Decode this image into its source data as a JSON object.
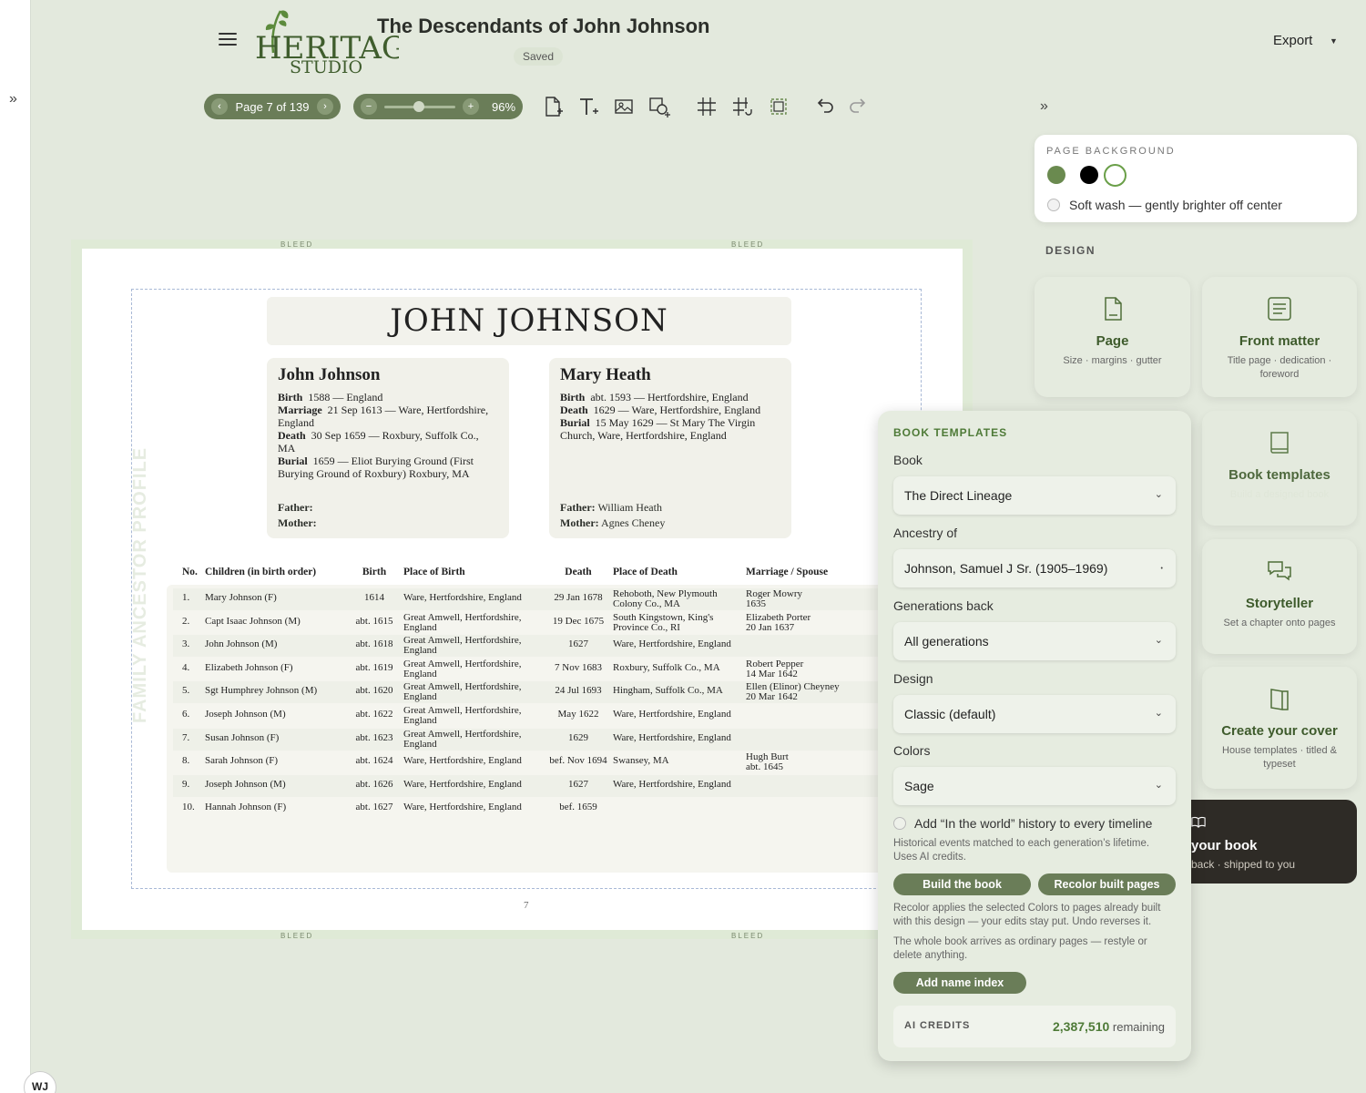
{
  "header": {
    "logo_text_top": "HERITAGE",
    "logo_text_bottom": "STUDIO",
    "title": "The Descendants of John Johnson",
    "saved_badge": "Saved",
    "export_label": "Export"
  },
  "toolbar": {
    "page_label": "Page 7 of 139",
    "zoom_label": "96%",
    "zoom_level_percent": 96,
    "tools": [
      "add-page-icon",
      "add-text-icon",
      "add-image-icon",
      "add-shape-icon",
      "grid-icon",
      "snap-grid-icon",
      "frame-icon",
      "undo-icon",
      "redo-icon"
    ]
  },
  "user": {
    "initials": "WJ"
  },
  "page_background": {
    "heading": "PAGE BACKGROUND",
    "swatches": [
      "#6a8a4f",
      "#000000",
      "#ffffff"
    ],
    "selected_swatch": "#ffffff",
    "soft_wash_label": "Soft wash — gently brighter off center"
  },
  "design": {
    "heading": "DESIGN",
    "cards": [
      {
        "title": "Page",
        "subtitle": "Size · margins · gutter",
        "icon": "page-icon"
      },
      {
        "title": "Front matter",
        "subtitle": "Title page · dedication · foreword",
        "icon": "document-lines-icon"
      },
      {
        "title": "Book templates",
        "subtitle": "Build a designed book",
        "icon": "book-icon"
      },
      {
        "title": "Storyteller",
        "subtitle": "Set a chapter onto pages",
        "icon": "chat-bubbles-icon"
      },
      {
        "title": "Create your cover",
        "subtitle": "House templates · titled & typeset",
        "icon": "cover-book-icon"
      },
      {
        "title": "your book",
        "subtitle": "back · shipped to you",
        "icon": "open-book-icon"
      }
    ]
  },
  "canvas": {
    "bleed_label": "BLEED",
    "vertical_label": "FAMILY ANCESTOR PROFILE",
    "name_banner": "JOHN JOHNSON",
    "page_number": "7",
    "father_card": {
      "name": "John Johnson",
      "facts": [
        {
          "label": "Birth",
          "value": "1588 — England"
        },
        {
          "label": "Marriage",
          "value": "21 Sep 1613 — Ware, Hertfordshire, England"
        },
        {
          "label": "Death",
          "value": "30 Sep 1659 — Roxbury, Suffolk Co., MA"
        },
        {
          "label": "Burial",
          "value": "1659 — Eliot Burying Ground (First Burying Ground of Roxbury) Roxbury, MA"
        }
      ],
      "father_label": "Father:",
      "father_value": "",
      "mother_label": "Mother:",
      "mother_value": ""
    },
    "mother_card": {
      "name": "Mary Heath",
      "facts": [
        {
          "label": "Birth",
          "value": "abt. 1593 — Hertfordshire, England"
        },
        {
          "label": "Death",
          "value": "1629 — Ware, Hertfordshire, England"
        },
        {
          "label": "Burial",
          "value": "15 May 1629 — St Mary The Virgin Church, Ware, Hertfordshire, England"
        }
      ],
      "father_label": "Father:",
      "father_value": "William Heath",
      "mother_label": "Mother:",
      "mother_value": "Agnes Cheney"
    },
    "children_table": {
      "headers": [
        "No.",
        "Children (in birth order)",
        "Birth",
        "Place of Birth",
        "Death",
        "Place of Death",
        "Marriage / Spouse"
      ],
      "rows": [
        [
          "1.",
          "Mary Johnson (F)",
          "1614",
          "Ware, Hertfordshire, England",
          "29 Jan 1678",
          "Rehoboth, New Plymouth\nColony Co., MA",
          "Roger Mowry\n1635"
        ],
        [
          "2.",
          "Capt Isaac Johnson (M)",
          "abt. 1615",
          "Great Amwell, Hertfordshire,\nEngland",
          "19 Dec 1675",
          "South Kingstown, King's\nProvince Co., RI",
          "Elizabeth Porter\n20 Jan 1637"
        ],
        [
          "3.",
          "John Johnson (M)",
          "abt. 1618",
          "Great Amwell, Hertfordshire,\nEngland",
          "1627",
          "Ware, Hertfordshire, England",
          ""
        ],
        [
          "4.",
          "Elizabeth Johnson (F)",
          "abt. 1619",
          "Great Amwell, Hertfordshire,\nEngland",
          "7 Nov 1683",
          "Roxbury, Suffolk Co., MA",
          "Robert Pepper\n14 Mar 1642"
        ],
        [
          "5.",
          "Sgt Humphrey Johnson (M)",
          "abt. 1620",
          "Great Amwell, Hertfordshire,\nEngland",
          "24 Jul 1693",
          "Hingham, Suffolk Co., MA",
          "Ellen (Elinor) Cheyney\n20 Mar 1642"
        ],
        [
          "6.",
          "Joseph Johnson (M)",
          "abt. 1622",
          "Great Amwell, Hertfordshire,\nEngland",
          "May 1622",
          "Ware, Hertfordshire, England",
          ""
        ],
        [
          "7.",
          "Susan Johnson (F)",
          "abt. 1623",
          "Great Amwell, Hertfordshire,\nEngland",
          "1629",
          "Ware, Hertfordshire, England",
          ""
        ],
        [
          "8.",
          "Sarah Johnson (F)",
          "abt. 1624",
          "Ware, Hertfordshire, England",
          "bef. Nov 1694",
          "Swansey, MA",
          "Hugh Burt\nabt. 1645"
        ],
        [
          "9.",
          "Joseph Johnson (M)",
          "abt. 1626",
          "Ware, Hertfordshire, England",
          "1627",
          "Ware, Hertfordshire, England",
          ""
        ],
        [
          "10.",
          "Hannah Johnson (F)",
          "abt. 1627",
          "Ware, Hertfordshire, England",
          "bef. 1659",
          "",
          ""
        ]
      ]
    }
  },
  "book_templates": {
    "heading": "BOOK TEMPLATES",
    "book_label": "Book",
    "book_value": "The Direct Lineage",
    "ancestry_label": "Ancestry of",
    "ancestry_value": "Johnson, Samuel J Sr. (1905–1969)",
    "generations_label": "Generations back",
    "generations_value": "All generations",
    "design_label": "Design",
    "design_value": "Classic (default)",
    "colors_label": "Colors",
    "colors_value": "Sage",
    "history_label": "Add “In the world” history to every timeline",
    "history_note": "Historical events matched to each generation’s lifetime. Uses AI credits.",
    "build_button": "Build the book",
    "recolor_button": "Recolor built pages",
    "recolor_note": "Recolor applies the selected Colors to pages already built with this design — your edits stay put. Undo reverses it.",
    "whole_book_note": "The whole book arrives as ordinary pages — restyle or delete anything.",
    "name_index_button": "Add name index",
    "credits_label": "AI CREDITS",
    "credits_value": "2,387,510",
    "credits_suffix": "remaining"
  }
}
